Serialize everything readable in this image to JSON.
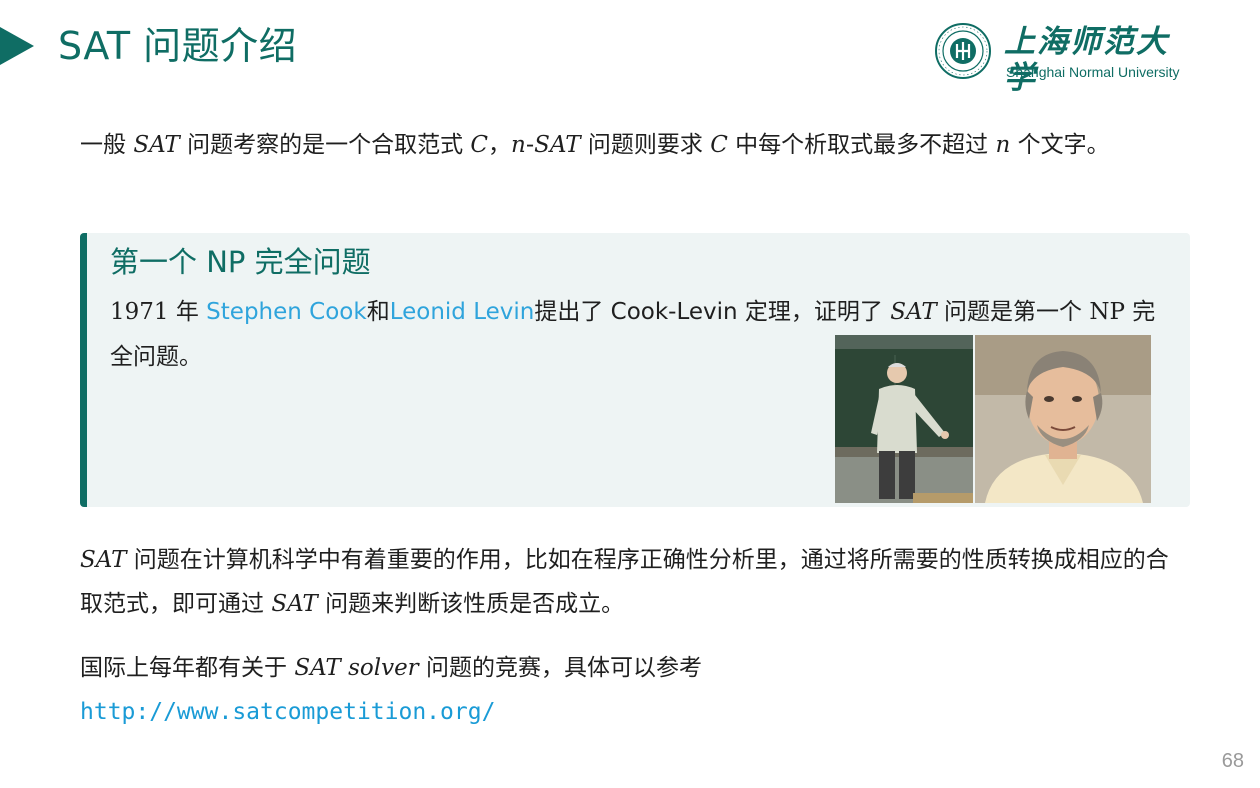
{
  "header": {
    "title": "SAT 问题介绍",
    "logo_cn": "上海师范大学",
    "logo_en": "Shanghai Normal University"
  },
  "intro": {
    "text_a": "一般 ",
    "sat": "SAT",
    "text_b": " 问题考察的是一个合取范式 ",
    "c1": "C",
    "text_c": "，",
    "n1": "n",
    "text_d": "-",
    "sat2": "SAT",
    "text_e": " 问题则要求 ",
    "c2": "C",
    "text_f": " 中每个析取式最多不超过 ",
    "n2": "n",
    "text_g": " 个文字。"
  },
  "block": {
    "title": "第一个 NP 完全问题",
    "year": "1971",
    "year_unit": " 年 ",
    "person1": "Stephen Cook",
    "and": "和",
    "person2": "Leonid Levin",
    "text_a": "提出了 Cook-Levin 定理，证明了 ",
    "sat": "SAT",
    "text_b": " 问题是第一个 ",
    "np": "NP",
    "text_c": " 完全问题。"
  },
  "para2": {
    "sat1": "SAT",
    "text_a": " 问题在计算机科学中有着重要的作用，比如在程序正确性分析里，通过将所需要的性质转换成相应的合取范式，即可通过 ",
    "sat2": "SAT",
    "text_b": " 问题来判断该性质是否成立。"
  },
  "para3": {
    "text_a": "国际上每年都有关于 ",
    "sat_solver": "SAT solver",
    "text_b": " 问题的竞赛，具体可以参考",
    "url": "http://www.satcompetition.org/"
  },
  "page_number": "68",
  "colors": {
    "accent": "#0f6d64",
    "link": "#2fa4dc",
    "block_bg": "#eef4f4"
  }
}
